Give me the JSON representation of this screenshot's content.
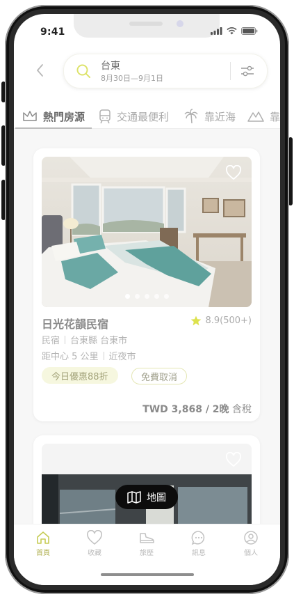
{
  "status_bar": {
    "time": "9:41"
  },
  "search": {
    "title": "台東",
    "dates": "8月30日—9月1日"
  },
  "tabs": [
    {
      "label": "熱門房源",
      "icon": "crown-icon",
      "active": true
    },
    {
      "label": "交通最便利",
      "icon": "train-icon",
      "active": false
    },
    {
      "label": "靠近海",
      "icon": "palm-tree-icon",
      "active": false
    },
    {
      "label": "靠",
      "icon": "mountain-icon",
      "active": false
    }
  ],
  "listings": [
    {
      "name": "日光花韻民宿",
      "rating": "8.9(500+)",
      "type": "民宿",
      "location": "台東縣 台東市",
      "distance": "距中心 5 公里",
      "nearby": "近夜市",
      "badge_deal": "今日優惠88折",
      "badge_free": "免費取消",
      "price": "TWD 3,868 / 2晚",
      "price_suffix": "含稅",
      "photo_count": 5,
      "photo_index": 1
    }
  ],
  "map_button": {
    "label": "地圖"
  },
  "bottom_nav": [
    {
      "label": "首頁",
      "icon": "home-icon",
      "active": true
    },
    {
      "label": "收藏",
      "icon": "heart-icon",
      "active": false
    },
    {
      "label": "旅歷",
      "icon": "shoe-icon",
      "active": false
    },
    {
      "label": "訊息",
      "icon": "chat-icon",
      "active": false
    },
    {
      "label": "個人",
      "icon": "user-icon",
      "active": false
    }
  ],
  "colors": {
    "accent": "#d8e34a",
    "accent_text": "#b0b050"
  }
}
